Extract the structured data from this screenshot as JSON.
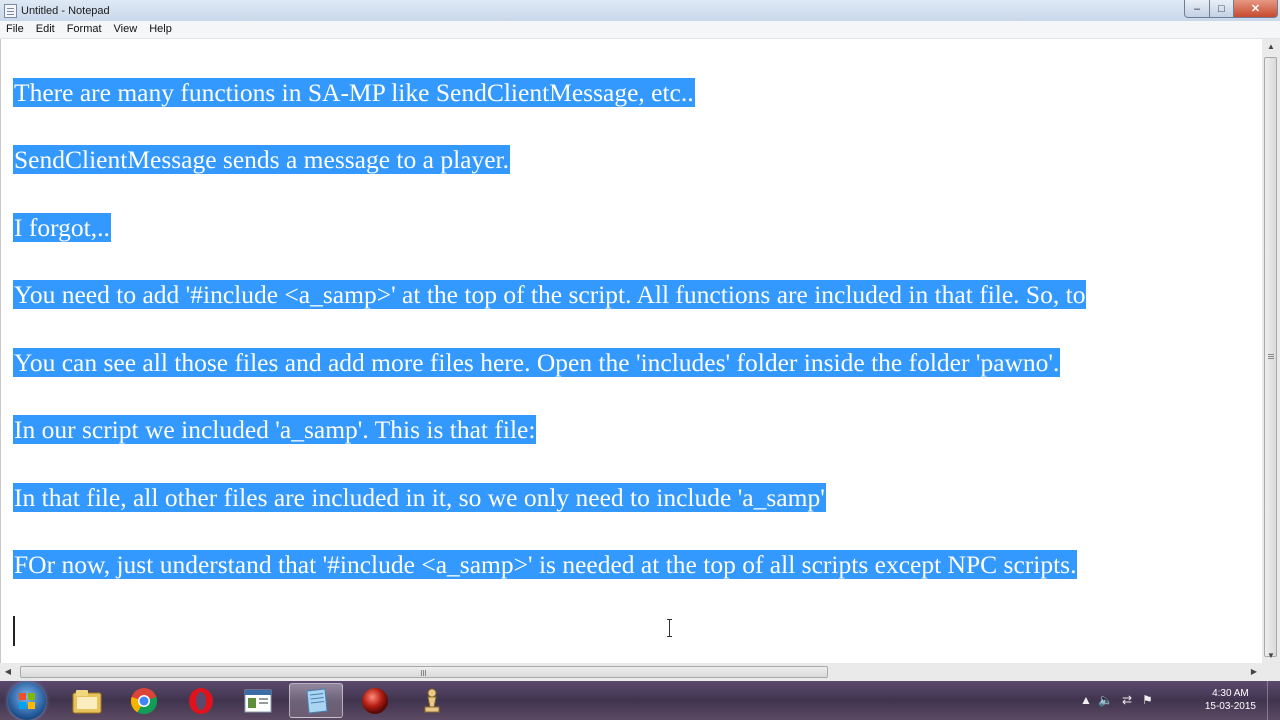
{
  "window": {
    "title": "Untitled - Notepad",
    "controls": {
      "minimize": "–",
      "maximize": "□",
      "close": "✕"
    }
  },
  "menu": [
    "File",
    "Edit",
    "Format",
    "View",
    "Help"
  ],
  "editor": {
    "lines": [
      "There are many functions in SA-MP like SendClientMessage, etc..",
      "SendClientMessage sends a message to a player.",
      "I forgot,..",
      "You need to add '#include <a_samp>' at the top of the script. All functions are included in that file. So, to",
      "You can see all those files and add more files here. Open the 'includes' folder inside the folder 'pawno'.",
      "In our script we included 'a_samp'. This is that file:",
      "In that file, all other files are included in it, so we only need to include 'a_samp'",
      "FOr now, just understand that '#include <a_samp>' is needed at the top of all scripts except NPC scripts."
    ],
    "selection_color": "#3399ff"
  },
  "scrollbars": {
    "up": "▲",
    "down": "▼",
    "left": "◀",
    "right": "▶"
  },
  "taskbar": {
    "items": [
      "file-explorer-icon",
      "chrome-icon",
      "opera-icon",
      "app-window-icon",
      "notepad-icon",
      "red-ball-icon",
      "chess-icon"
    ],
    "tray": {
      "chevron": "▲",
      "volume": "🔈",
      "network": "⇄",
      "flag": "⚑"
    },
    "clock": {
      "time": "4:30 AM",
      "date": "15-03-2015"
    }
  }
}
